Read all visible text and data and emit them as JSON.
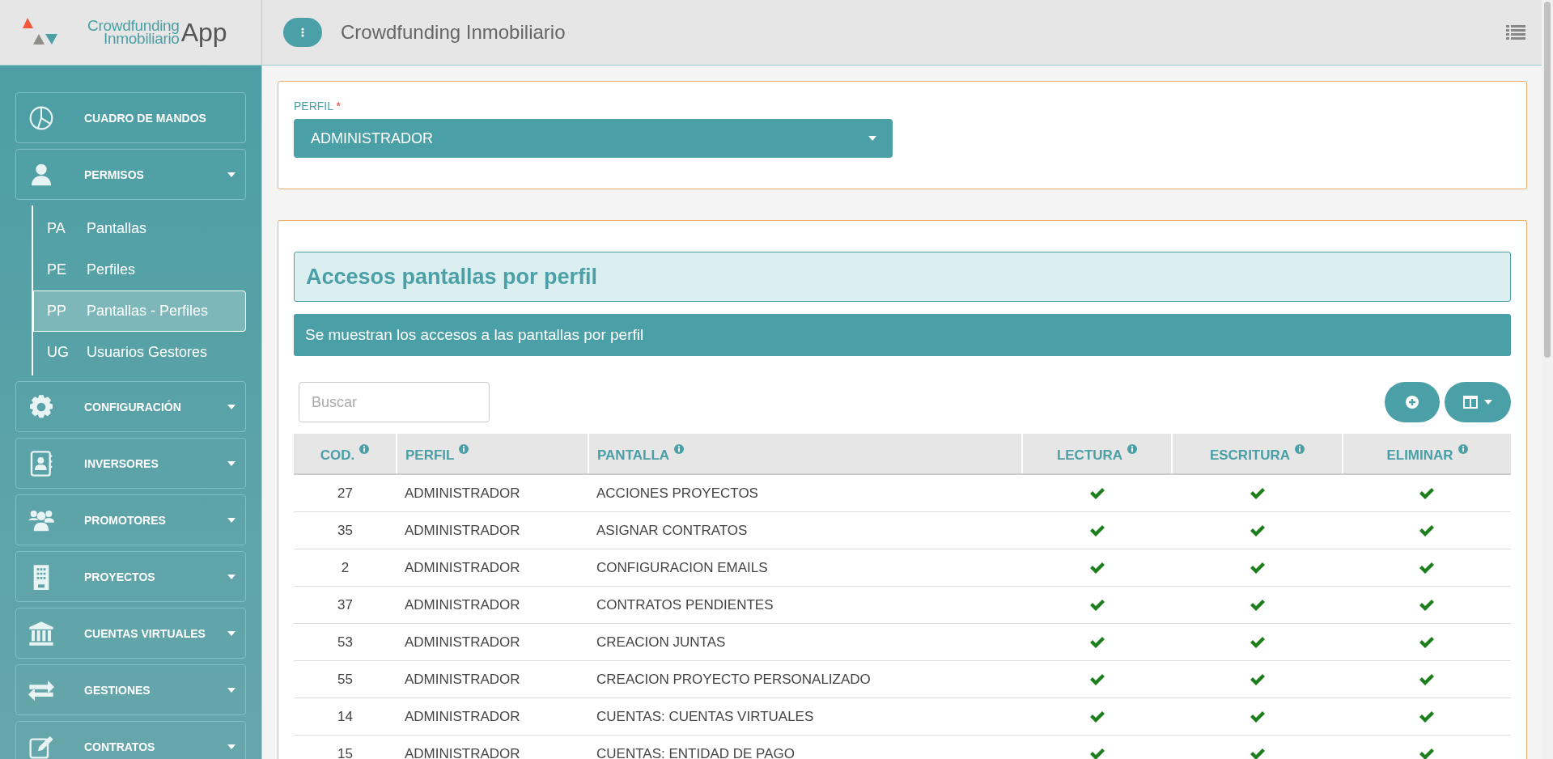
{
  "logo": {
    "line_1": "Crowdfunding",
    "line_2": "Inmobiliario",
    "suffix": "App"
  },
  "header": {
    "title": "Crowdfunding Inmobiliario"
  },
  "sidebar": {
    "items": [
      {
        "label": "CUADRO DE MANDOS",
        "kind": "link"
      },
      {
        "label": "PERMISOS",
        "kind": "group",
        "expanded": true,
        "children": [
          {
            "abbr": "PA",
            "label": "Pantallas",
            "selected": false
          },
          {
            "abbr": "PE",
            "label": "Perfiles",
            "selected": false
          },
          {
            "abbr": "PP",
            "label": "Pantallas - Perfiles",
            "selected": true
          },
          {
            "abbr": "UG",
            "label": "Usuarios Gestores",
            "selected": false
          }
        ]
      },
      {
        "label": "CONFIGURACIÓN",
        "kind": "group"
      },
      {
        "label": "INVERSORES",
        "kind": "group"
      },
      {
        "label": "PROMOTORES",
        "kind": "group"
      },
      {
        "label": "PROYECTOS",
        "kind": "group"
      },
      {
        "label": "CUENTAS VIRTUALES",
        "kind": "group"
      },
      {
        "label": "GESTIONES",
        "kind": "group"
      },
      {
        "label": "CONTRATOS",
        "kind": "group"
      }
    ]
  },
  "profile": {
    "label": "PERFIL",
    "required_mark": "*",
    "value": "ADMINISTRADOR"
  },
  "section": {
    "title": "Accesos pantallas por perfil",
    "info": "Se muestran los accesos a las pantallas por perfil"
  },
  "search": {
    "placeholder": "Buscar"
  },
  "table": {
    "columns": [
      "COD.",
      "PERFIL",
      "PANTALLA",
      "LECTURA",
      "ESCRITURA",
      "ELIMINAR"
    ],
    "rows": [
      {
        "cod": "27",
        "perfil": "ADMINISTRADOR",
        "pantalla": "ACCIONES PROYECTOS",
        "lectura": true,
        "escritura": true,
        "eliminar": true
      },
      {
        "cod": "35",
        "perfil": "ADMINISTRADOR",
        "pantalla": "ASIGNAR CONTRATOS",
        "lectura": true,
        "escritura": true,
        "eliminar": true
      },
      {
        "cod": "2",
        "perfil": "ADMINISTRADOR",
        "pantalla": "CONFIGURACION EMAILS",
        "lectura": true,
        "escritura": true,
        "eliminar": true
      },
      {
        "cod": "37",
        "perfil": "ADMINISTRADOR",
        "pantalla": "CONTRATOS PENDIENTES",
        "lectura": true,
        "escritura": true,
        "eliminar": true
      },
      {
        "cod": "53",
        "perfil": "ADMINISTRADOR",
        "pantalla": "CREACION JUNTAS",
        "lectura": true,
        "escritura": true,
        "eliminar": true
      },
      {
        "cod": "55",
        "perfil": "ADMINISTRADOR",
        "pantalla": "CREACION PROYECTO PERSONALIZADO",
        "lectura": true,
        "escritura": true,
        "eliminar": true
      },
      {
        "cod": "14",
        "perfil": "ADMINISTRADOR",
        "pantalla": "CUENTAS: CUENTAS VIRTUALES",
        "lectura": true,
        "escritura": true,
        "eliminar": true
      },
      {
        "cod": "15",
        "perfil": "ADMINISTRADOR",
        "pantalla": "CUENTAS: ENTIDAD DE PAGO",
        "lectura": true,
        "escritura": true,
        "eliminar": true
      }
    ]
  }
}
